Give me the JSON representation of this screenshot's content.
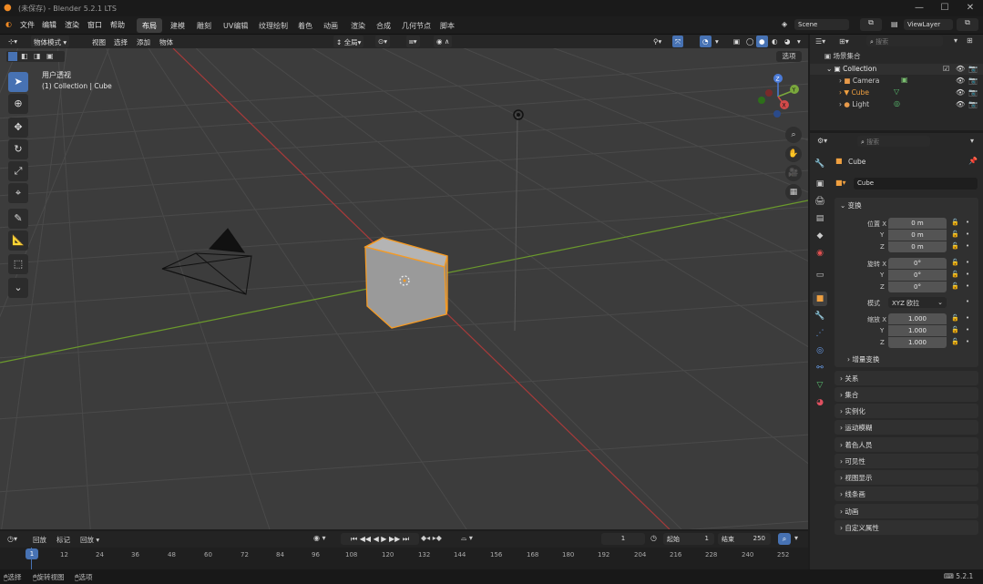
{
  "app": {
    "title": "(未保存) - Blender 5.2.1 LTS",
    "minimize": "—",
    "maximize": "☐",
    "close": "✕"
  },
  "menu": [
    "文件",
    "编辑",
    "渲染",
    "窗口",
    "帮助"
  ],
  "workspaces": [
    "布局",
    "建模",
    "雕刻",
    "UV编辑",
    "纹理绘制",
    "着色",
    "动画",
    "渲染",
    "合成",
    "几何节点",
    "脚本"
  ],
  "scene": {
    "label": "Scene",
    "viewlayer": "ViewLayer"
  },
  "viewport_header": {
    "mode": "物体模式",
    "view": "视图",
    "select": "选择",
    "add": "添加",
    "object": "物体",
    "transform": "全局",
    "options": "选项"
  },
  "viewport": {
    "view_name": "用户透视",
    "collection_info": "(1) Collection | Cube"
  },
  "outliner": {
    "search_placeholder": "搜索",
    "title": "场景集合",
    "items": [
      {
        "name": "Collection"
      },
      {
        "name": "Camera"
      },
      {
        "name": "Cube"
      },
      {
        "name": "Light"
      }
    ]
  },
  "properties": {
    "search_placeholder": "搜索",
    "object_name": "Cube",
    "datablock_name": "Cube",
    "transform_title": "变换",
    "location_label": "位置",
    "rotation_label": "旋转",
    "scale_label": "缩放",
    "mode_label": "模式",
    "mode_value": "XYZ 欧拉",
    "x": "X",
    "y": "Y",
    "z": "Z",
    "location": [
      "0 m",
      "0 m",
      "0 m"
    ],
    "rotation": [
      "0°",
      "0°",
      "0°"
    ],
    "scale": [
      "1.000",
      "1.000",
      "1.000"
    ],
    "delta": "增量变换",
    "panels": [
      "关系",
      "集合",
      "实例化",
      "运动模糊",
      "着色人员",
      "可见性",
      "视图显示",
      "线条画",
      "动画",
      "自定义属性"
    ]
  },
  "timeline": {
    "menu": [
      "回放",
      "标记"
    ],
    "view": "回放",
    "current_frame": "1",
    "start_label": "起始",
    "start": "1",
    "end_label": "结束",
    "end": "250",
    "ticks": [
      "1",
      "12",
      "24",
      "36",
      "48",
      "60",
      "72",
      "84",
      "96",
      "108",
      "120",
      "132",
      "144",
      "156",
      "168",
      "180",
      "192",
      "204",
      "216",
      "228",
      "240",
      "252"
    ]
  },
  "status": {
    "select": "选择",
    "rotate": "旋转视图",
    "options": "选项",
    "version": "5.2.1"
  }
}
